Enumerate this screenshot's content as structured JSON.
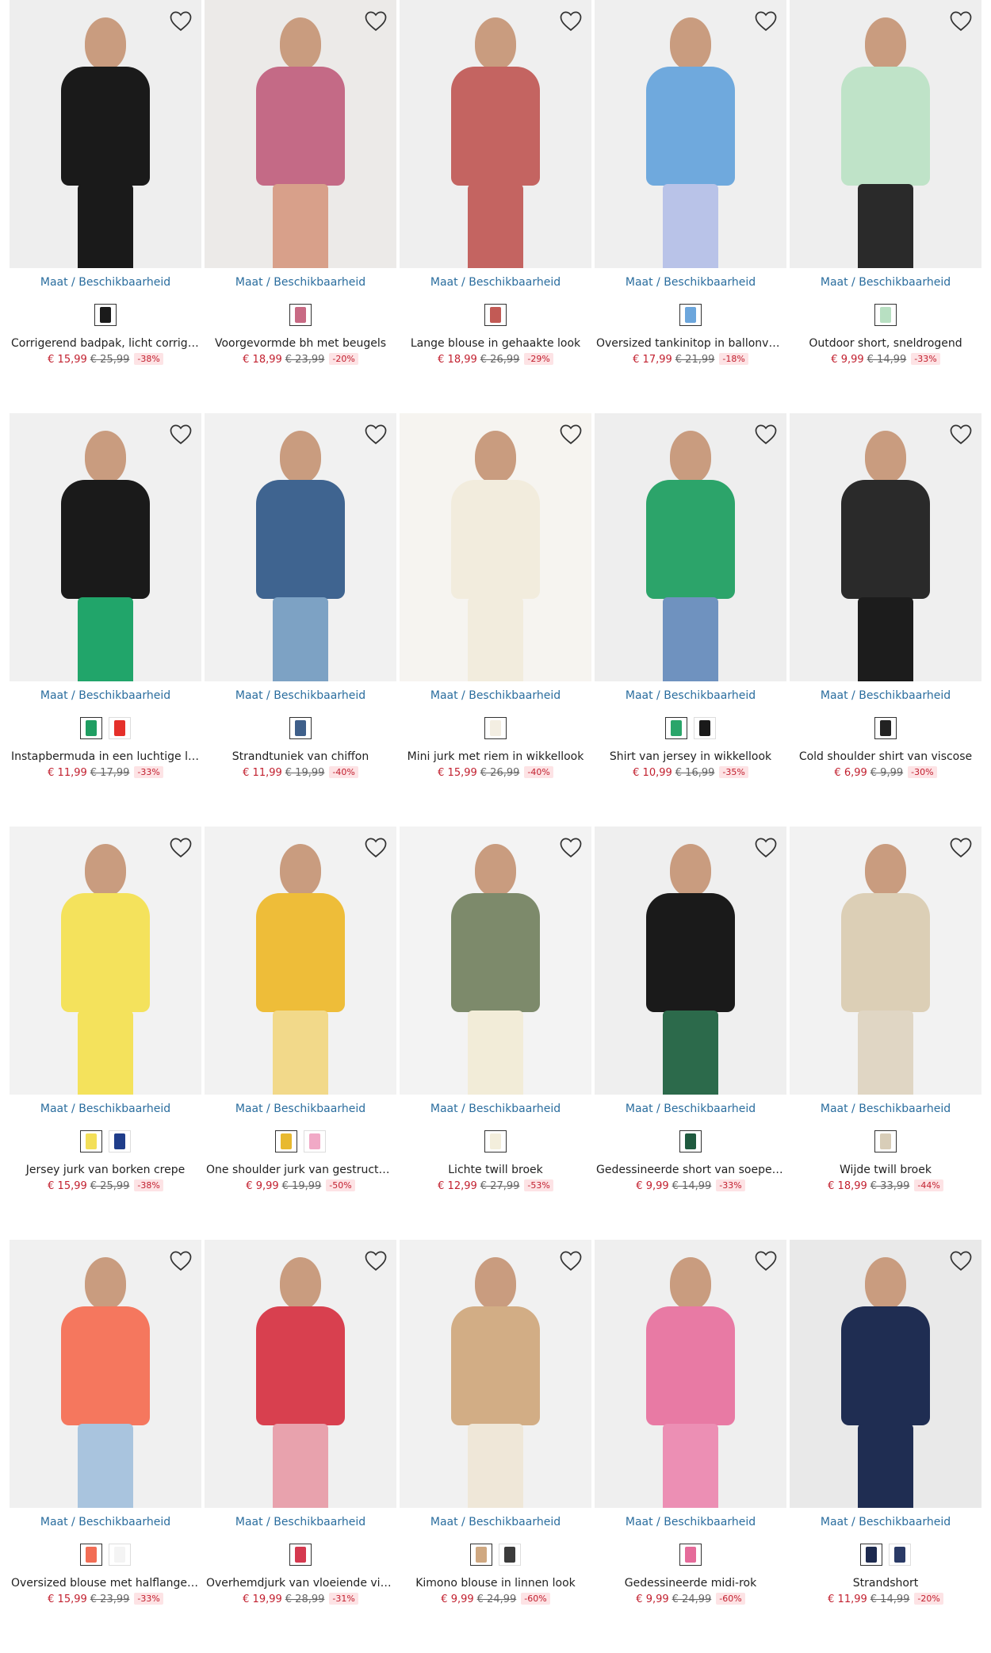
{
  "labels": {
    "size_link": "Maat / Beschikbaarheid"
  },
  "products": [
    {
      "name": "Corrigerend badpak, licht corrigerend",
      "price": "€ 15,99",
      "old_price": "€ 25,99",
      "discount": "-38%",
      "swatches": [
        "#1b1b1b"
      ],
      "colors": {
        "top": "#1a1a1a",
        "bottom": "#1a1a1a",
        "bg": "#eeeeee"
      }
    },
    {
      "name": "Voorgevormde bh met beugels",
      "price": "€ 18,99",
      "old_price": "€ 23,99",
      "discount": "-20%",
      "swatches": [
        "#c86a84"
      ],
      "colors": {
        "top": "#c46a86",
        "bottom": "#d8a08a",
        "bg": "#eceae8"
      }
    },
    {
      "name": "Lange blouse in gehaakte look",
      "price": "€ 18,99",
      "old_price": "€ 26,99",
      "discount": "-29%",
      "swatches": [
        "#c25a55"
      ],
      "colors": {
        "top": "#c46461",
        "bottom": "#c46461",
        "bg": "#efefef"
      }
    },
    {
      "name": "Oversized tankinitop in ballonvorm",
      "price": "€ 17,99",
      "old_price": "€ 21,99",
      "discount": "-18%",
      "swatches": [
        "#6ca6dc"
      ],
      "colors": {
        "top": "#6fa9dd",
        "bottom": "#b9c3e8",
        "bg": "#efefef"
      }
    },
    {
      "name": "Outdoor short, sneldrogend",
      "price": "€ 9,99",
      "old_price": "€ 14,99",
      "discount": "-33%",
      "swatches": [
        "#b8e0c2"
      ],
      "colors": {
        "top": "#bfe3c8",
        "bottom": "#2a2a2a",
        "bg": "#eeeeee"
      }
    },
    {
      "name": "Instapbermuda in een luchtige linnen look",
      "price": "€ 11,99",
      "old_price": "€ 17,99",
      "discount": "-33%",
      "swatches": [
        "#1f9e62",
        "#e5302a"
      ],
      "colors": {
        "top": "#1a1a1a",
        "bottom": "#21a56a",
        "bg": "#f0f0f0"
      }
    },
    {
      "name": "Strandtuniek van chiffon",
      "price": "€ 11,99",
      "old_price": "€ 19,99",
      "discount": "-40%",
      "swatches": [
        "#3e5f8a"
      ],
      "colors": {
        "top": "#3f6490",
        "bottom": "#7da2c4",
        "bg": "#f1f1f1"
      }
    },
    {
      "name": "Mini jurk met riem in wikkellook",
      "price": "€ 15,99",
      "old_price": "€ 26,99",
      "discount": "-40%",
      "swatches": [
        "#f3eee2"
      ],
      "colors": {
        "top": "#f2ecdd",
        "bottom": "#f2ecdd",
        "bg": "#f6f4f0"
      }
    },
    {
      "name": "Shirt van jersey in wikkellook",
      "price": "€ 10,99",
      "old_price": "€ 16,99",
      "discount": "-35%",
      "swatches": [
        "#2aa56a",
        "#1a1a1a"
      ],
      "colors": {
        "top": "#2ca46a",
        "bottom": "#6f92bf",
        "bg": "#eeeeee"
      }
    },
    {
      "name": "Cold shoulder shirt van viscose",
      "price": "€ 6,99",
      "old_price": "€ 9,99",
      "discount": "-30%",
      "swatches": [
        "#222222"
      ],
      "colors": {
        "top": "#2a2a2a",
        "bottom": "#1c1c1c",
        "bg": "#efefef"
      }
    },
    {
      "name": "Jersey jurk van borken crepe",
      "price": "€ 15,99",
      "old_price": "€ 25,99",
      "discount": "-38%",
      "swatches": [
        "#f3df58",
        "#1f3d8a"
      ],
      "colors": {
        "top": "#f4e25c",
        "bottom": "#f4e25c",
        "bg": "#f2f2f2"
      }
    },
    {
      "name": "One shoulder jurk van gestructureerde viscose",
      "price": "€ 9,99",
      "old_price": "€ 19,99",
      "discount": "-50%",
      "swatches": [
        "#e8b92f",
        "#f1a9c6"
      ],
      "colors": {
        "top": "#eebd39",
        "bottom": "#f2d98a",
        "bg": "#f2f2f2"
      }
    },
    {
      "name": "Lichte twill broek",
      "price": "€ 12,99",
      "old_price": "€ 27,99",
      "discount": "-53%",
      "swatches": [
        "#f3eedc"
      ],
      "colors": {
        "top": "#7d8a6b",
        "bottom": "#f2ecd8",
        "bg": "#f3f3f3"
      }
    },
    {
      "name": "Gedessineerde short van soepele viscose",
      "price": "€ 9,99",
      "old_price": "€ 14,99",
      "discount": "-33%",
      "swatches": [
        "#1f5a3f"
      ],
      "colors": {
        "top": "#1a1a1a",
        "bottom": "#2c6a4b",
        "bg": "#efefef"
      }
    },
    {
      "name": "Wijde twill broek",
      "price": "€ 18,99",
      "old_price": "€ 33,99",
      "discount": "-44%",
      "swatches": [
        "#d8cdb8"
      ],
      "colors": {
        "top": "#dccfb6",
        "bottom": "#e0d6c4",
        "bg": "#f2f2f2"
      }
    },
    {
      "name": "Oversized blouse met halflange mouwen",
      "price": "€ 15,99",
      "old_price": "€ 23,99",
      "discount": "-33%",
      "swatches": [
        "#f26d55",
        "#f4f4f4"
      ],
      "colors": {
        "top": "#f5775e",
        "bottom": "#a9c4de",
        "bg": "#f0f0f0"
      }
    },
    {
      "name": "Overhemdjurk van vloeiende viscose",
      "price": "€ 19,99",
      "old_price": "€ 28,99",
      "discount": "-31%",
      "swatches": [
        "#d5394f"
      ],
      "colors": {
        "top": "#d8404f",
        "bottom": "#e8a2ad",
        "bg": "#f0f0f0"
      }
    },
    {
      "name": "Kimono blouse in linnen look",
      "price": "€ 9,99",
      "old_price": "€ 24,99",
      "discount": "-60%",
      "swatches": [
        "#cfa881",
        "#3b3b3b"
      ],
      "colors": {
        "top": "#d2ad85",
        "bottom": "#efe7d8",
        "bg": "#f1f1f1"
      }
    },
    {
      "name": "Gedessineerde midi-rok",
      "price": "€ 9,99",
      "old_price": "€ 24,99",
      "discount": "-60%",
      "swatches": [
        "#e56b9a"
      ],
      "colors": {
        "top": "#e87aa4",
        "bottom": "#ec8fb4",
        "bg": "#efefef"
      }
    },
    {
      "name": "Strandshort",
      "price": "€ 11,99",
      "old_price": "€ 14,99",
      "discount": "-20%",
      "swatches": [
        "#1d2a4f",
        "#2a3a66"
      ],
      "colors": {
        "top": "#1f2d52",
        "bottom": "#1f2d52",
        "bg": "#e9e9e9"
      }
    }
  ]
}
